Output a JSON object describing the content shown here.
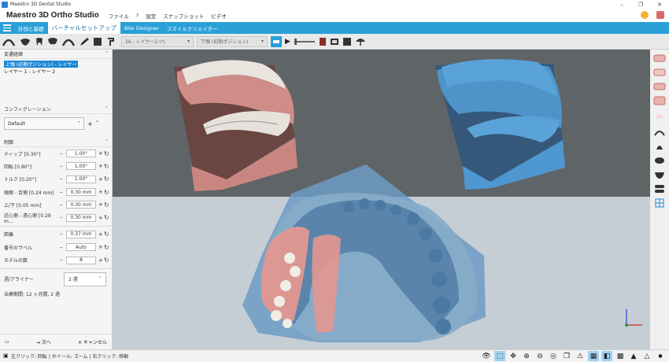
{
  "window": {
    "title": "Maestro 3D Dental Studio",
    "controls": [
      "–",
      "❐",
      "✕"
    ]
  },
  "menubar": {
    "brand": "Maestro 3D Ortho Studio",
    "items": [
      "ファイル",
      "?",
      "設定",
      "スナップショット",
      "ビデオ"
    ]
  },
  "tabs": [
    "計測と基礎",
    "バーチャルセットアップ",
    "Bite Designer",
    "スマイルクリエイター"
  ],
  "toolbar": {
    "upper_layer": "26 - レイヤー2 (*)",
    "lower_layer": "下顎 (初期ポジション)"
  },
  "panel": {
    "history": {
      "title": "変遷経緯",
      "items": [
        "上顎 (初期ポジション) - レイヤー",
        "レイヤー 1 - レイヤー 2"
      ]
    },
    "config": {
      "title": "コンフィグレーション",
      "value": "Default"
    },
    "control": {
      "title": "制御",
      "rows": [
        {
          "label": "ティップ [0.30°]",
          "value": "1.00°"
        },
        {
          "label": "回転 [0.80°]",
          "value": "1.00°"
        },
        {
          "label": "トルク [0.20°]",
          "value": "1.00°"
        },
        {
          "label": "頬側 - 舌側 [0.24 mm]",
          "value": "0.30 mm"
        },
        {
          "label": "上/下 [0.05 mm]",
          "value": "0.30 mm"
        },
        {
          "label": "近心側 - 遠心側 [0.29 m…",
          "value": "0.30 mm"
        }
      ],
      "distance_label": "距離",
      "distance_value": "0.37 mm",
      "stage_label": "番号のラベル",
      "stage_value": "Auto",
      "models_label": "モデルの数",
      "models_value": "8",
      "aligner_label": "週/アライナー",
      "aligner_value": "2 週",
      "duration": "治療期間: 12 ヶ月間, 2 週"
    },
    "footer": {
      "next": "次へ",
      "cancel": "キャンセル"
    }
  },
  "statusbar": {
    "hint": "左クリック: 回転 | ホイール: ズーム | 右クリック: 移動"
  },
  "colors": {
    "accent": "#2aa0d8",
    "upper_model": "#d08a84",
    "lower_model": "#4a95cc",
    "selection": "#1e88d6"
  }
}
